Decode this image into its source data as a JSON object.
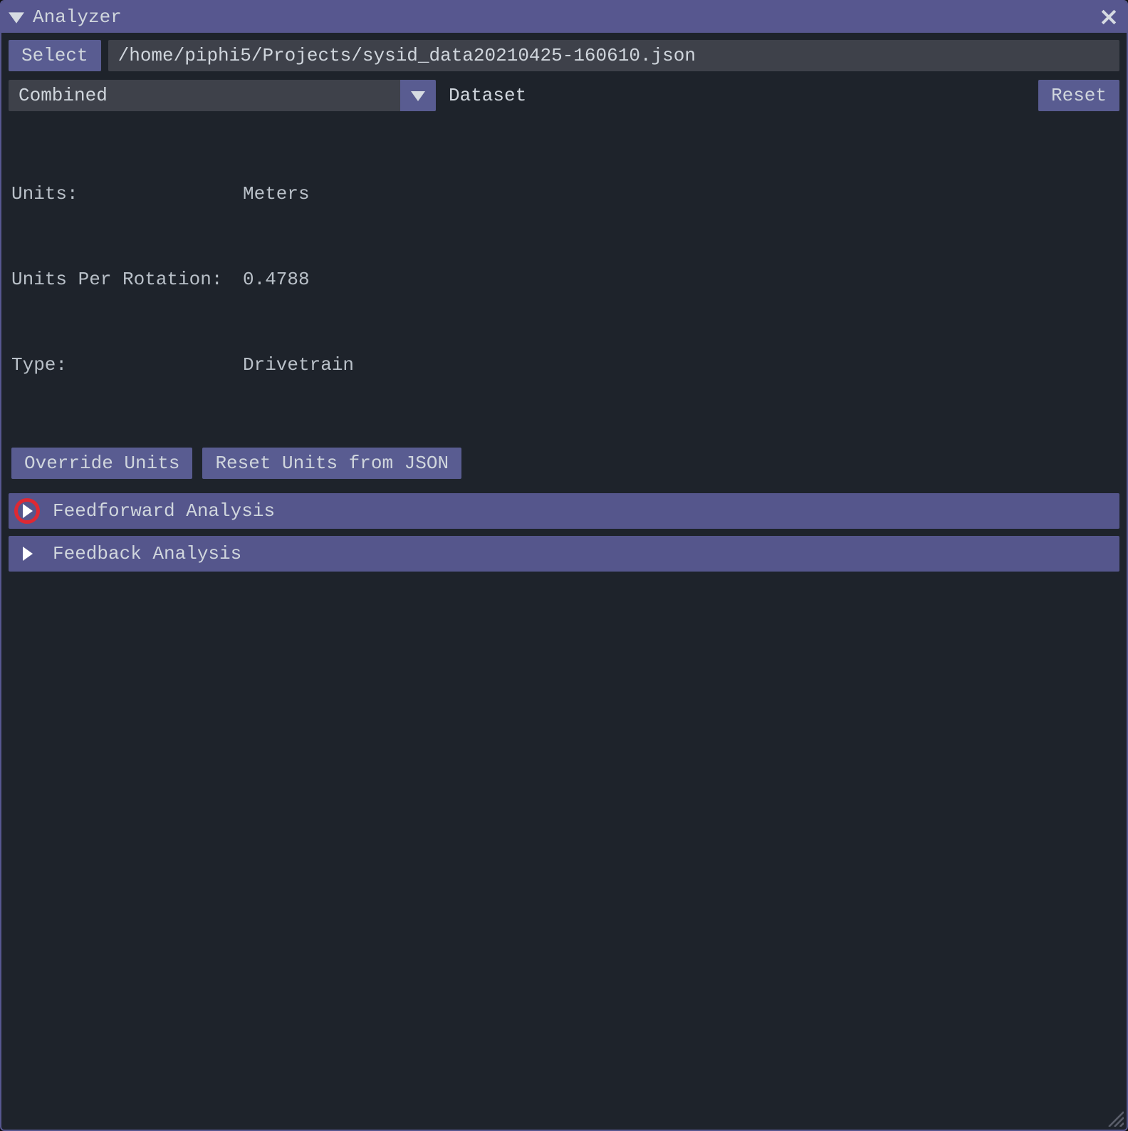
{
  "window": {
    "title": "Analyzer"
  },
  "file_row": {
    "select_label": "Select",
    "path": "/home/piphi5/Projects/sysid_data20210425-160610.json"
  },
  "dataset_row": {
    "combo_value": "Combined",
    "label": "Dataset",
    "reset_label": "Reset"
  },
  "meta": {
    "units_key": "Units:",
    "units_value": "Meters",
    "upr_key": "Units Per Rotation:",
    "upr_value": "0.4788",
    "type_key": "Type:",
    "type_value": "Drivetrain"
  },
  "unit_buttons": {
    "override": "Override Units",
    "reset_json": "Reset Units from JSON"
  },
  "sections": {
    "feedforward": "Feedforward Analysis",
    "feedback": "Feedback Analysis"
  }
}
